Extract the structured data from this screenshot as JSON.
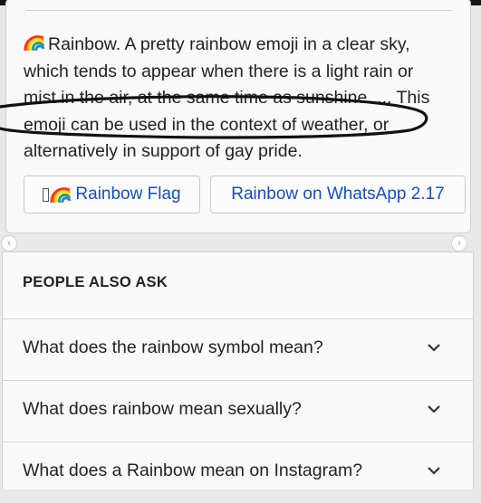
{
  "snippet": {
    "emoji_icon": "rainbow-emoji",
    "text": "Rainbow. A pretty rainbow emoji in a clear sky, which tends to appear when there is a light rain or mist in the air, at the same time as sunshine. ... This emoji can be used in the context of weather, or alternatively in support of gay pride."
  },
  "chips": [
    {
      "label": "Rainbow Flag",
      "icon": "rainbow-flag-emoji"
    },
    {
      "label": "Rainbow on WhatsApp 2.17"
    }
  ],
  "people_also_ask": {
    "title": "PEOPLE ALSO ASK",
    "questions": [
      "What does the rainbow symbol mean?",
      "What does rainbow mean sexually?",
      "What does a Rainbow mean on Instagram?"
    ]
  },
  "colors": {
    "link": "#1a4fb0",
    "ink_annotation": "#111111"
  }
}
